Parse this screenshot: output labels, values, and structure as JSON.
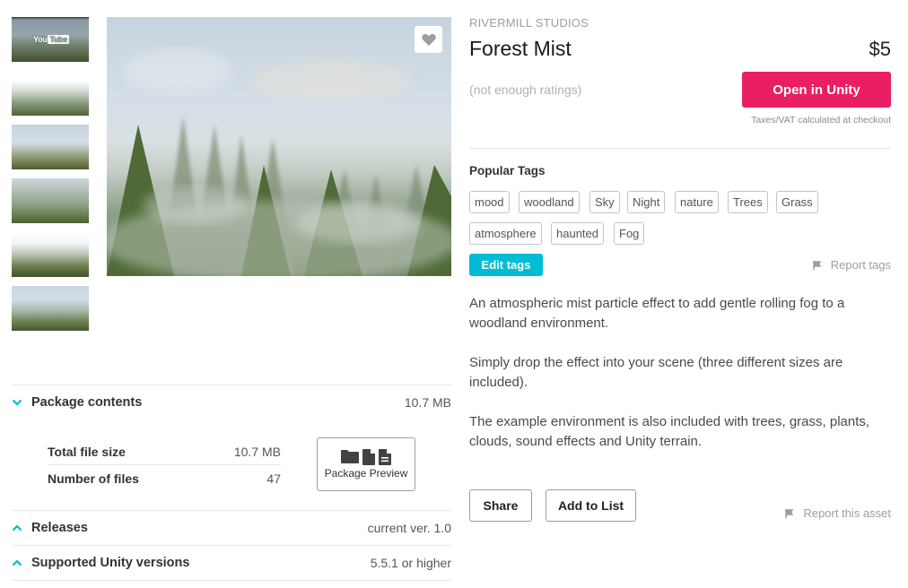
{
  "gallery": {
    "thumbnails": [
      {
        "type": "video",
        "overlay": "YouTube",
        "overlay_parts": [
          "You",
          "Tube"
        ]
      },
      {
        "type": "image"
      },
      {
        "type": "image"
      },
      {
        "type": "image"
      },
      {
        "type": "image"
      },
      {
        "type": "image"
      }
    ],
    "favorite_icon": "heart-icon"
  },
  "product": {
    "publisher": "RIVERMILL STUDIOS",
    "title": "Forest Mist",
    "price": "$5",
    "ratings": "(not enough ratings)",
    "open_button": "Open in Unity",
    "tax_note": "Taxes/VAT calculated at checkout",
    "accent_color": "#e91e63"
  },
  "tags": {
    "title": "Popular Tags",
    "items": [
      "mood",
      "woodland",
      "Sky",
      "Night",
      "nature",
      "Trees",
      "Grass",
      "atmosphere",
      "haunted",
      "Fog"
    ],
    "edit_label": "Edit tags",
    "report_label": "Report tags",
    "edit_color": "#00bcd4"
  },
  "description": {
    "paragraphs": [
      "An atmospheric mist particle effect to add gentle rolling fog to a woodland environment.",
      "Simply drop the effect into your scene (three different sizes are included).",
      "The example environment is also included with trees, grass, plants, clouds, sound effects and Unity terrain."
    ]
  },
  "actions": {
    "share": "Share",
    "add_to_list": "Add to List",
    "report_asset": "Report this asset"
  },
  "accordion": {
    "package_contents": {
      "label": "Package contents",
      "value": "10.7 MB",
      "expanded": true,
      "rows": [
        {
          "key": "Total file size",
          "value": "10.7 MB"
        },
        {
          "key": "Number of files",
          "value": "47"
        }
      ],
      "preview_label": "Package Preview"
    },
    "releases": {
      "label": "Releases",
      "value": "current ver. 1.0",
      "expanded": false
    },
    "unity_versions": {
      "label": "Supported Unity versions",
      "value": "5.5.1 or higher",
      "expanded": false
    }
  }
}
